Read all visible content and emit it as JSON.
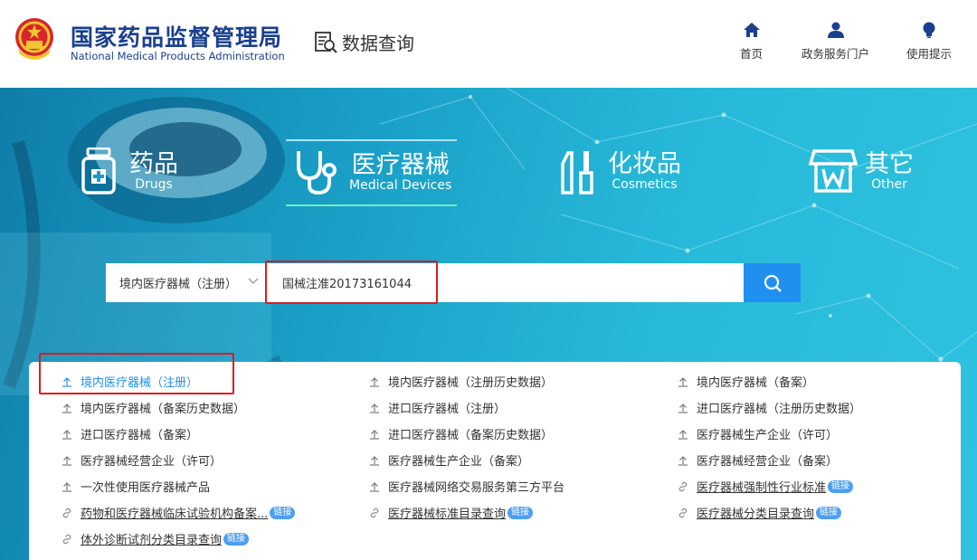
{
  "header": {
    "org_name_cn": "国家药品监督管理局",
    "org_name_en": "National Medical Products Administration",
    "section_title": "数据查询",
    "nav": [
      {
        "label": "首页",
        "icon": "home-icon"
      },
      {
        "label": "政务服务门户",
        "icon": "user-icon"
      },
      {
        "label": "使用提示",
        "icon": "tip-icon"
      }
    ]
  },
  "categories": [
    {
      "cn": "药品",
      "en": "Drugs",
      "icon": "drug-bottle-icon"
    },
    {
      "cn": "医疗器械",
      "en": "Medical Devices",
      "icon": "stethoscope-icon",
      "active": true
    },
    {
      "cn": "化妆品",
      "en": "Cosmetics",
      "icon": "cosmetics-icon"
    },
    {
      "cn": "其它",
      "en": "Other",
      "icon": "store-icon"
    }
  ],
  "search": {
    "selected_type": "境内医疗器械（注册）",
    "query": "国械注准20173161044"
  },
  "links": [
    {
      "label": "境内医疗器械（注册）",
      "icon": "upload-icon",
      "active": true
    },
    {
      "label": "境内医疗器械（注册历史数据）",
      "icon": "upload-icon"
    },
    {
      "label": "境内医疗器械（备案）",
      "icon": "upload-icon"
    },
    {
      "label": "境内医疗器械（备案历史数据）",
      "icon": "upload-icon"
    },
    {
      "label": "进口医疗器械（注册）",
      "icon": "upload-icon"
    },
    {
      "label": "进口医疗器械（注册历史数据）",
      "icon": "upload-icon"
    },
    {
      "label": "进口医疗器械（备案）",
      "icon": "upload-icon"
    },
    {
      "label": "进口医疗器械（备案历史数据）",
      "icon": "upload-icon"
    },
    {
      "label": "医疗器械生产企业（许可）",
      "icon": "upload-icon"
    },
    {
      "label": "医疗器械经营企业（许可）",
      "icon": "upload-icon"
    },
    {
      "label": "医疗器械生产企业（备案）",
      "icon": "upload-icon"
    },
    {
      "label": "医疗器械经营企业（备案）",
      "icon": "upload-icon"
    },
    {
      "label": "一次性使用医疗器械产品",
      "icon": "upload-icon"
    },
    {
      "label": "医疗器械网络交易服务第三方平台",
      "icon": "upload-icon"
    },
    {
      "label": "医疗器械强制性行业标准",
      "icon": "link-icon",
      "badge": "链接"
    },
    {
      "label": "药物和医疗器械临床试验机构备案...",
      "icon": "link-icon",
      "badge": "链接"
    },
    {
      "label": "医疗器械标准目录查询",
      "icon": "link-icon",
      "badge": "链接"
    },
    {
      "label": "医疗器械分类目录查询",
      "icon": "link-icon",
      "badge": "链接"
    },
    {
      "label": "体外诊断试剂分类目录查询",
      "icon": "link-icon",
      "badge": "链接"
    }
  ],
  "colors": {
    "brand_blue": "#1a3f8f",
    "accent_blue": "#1f8ff0",
    "highlight_red": "#e01b1b"
  }
}
